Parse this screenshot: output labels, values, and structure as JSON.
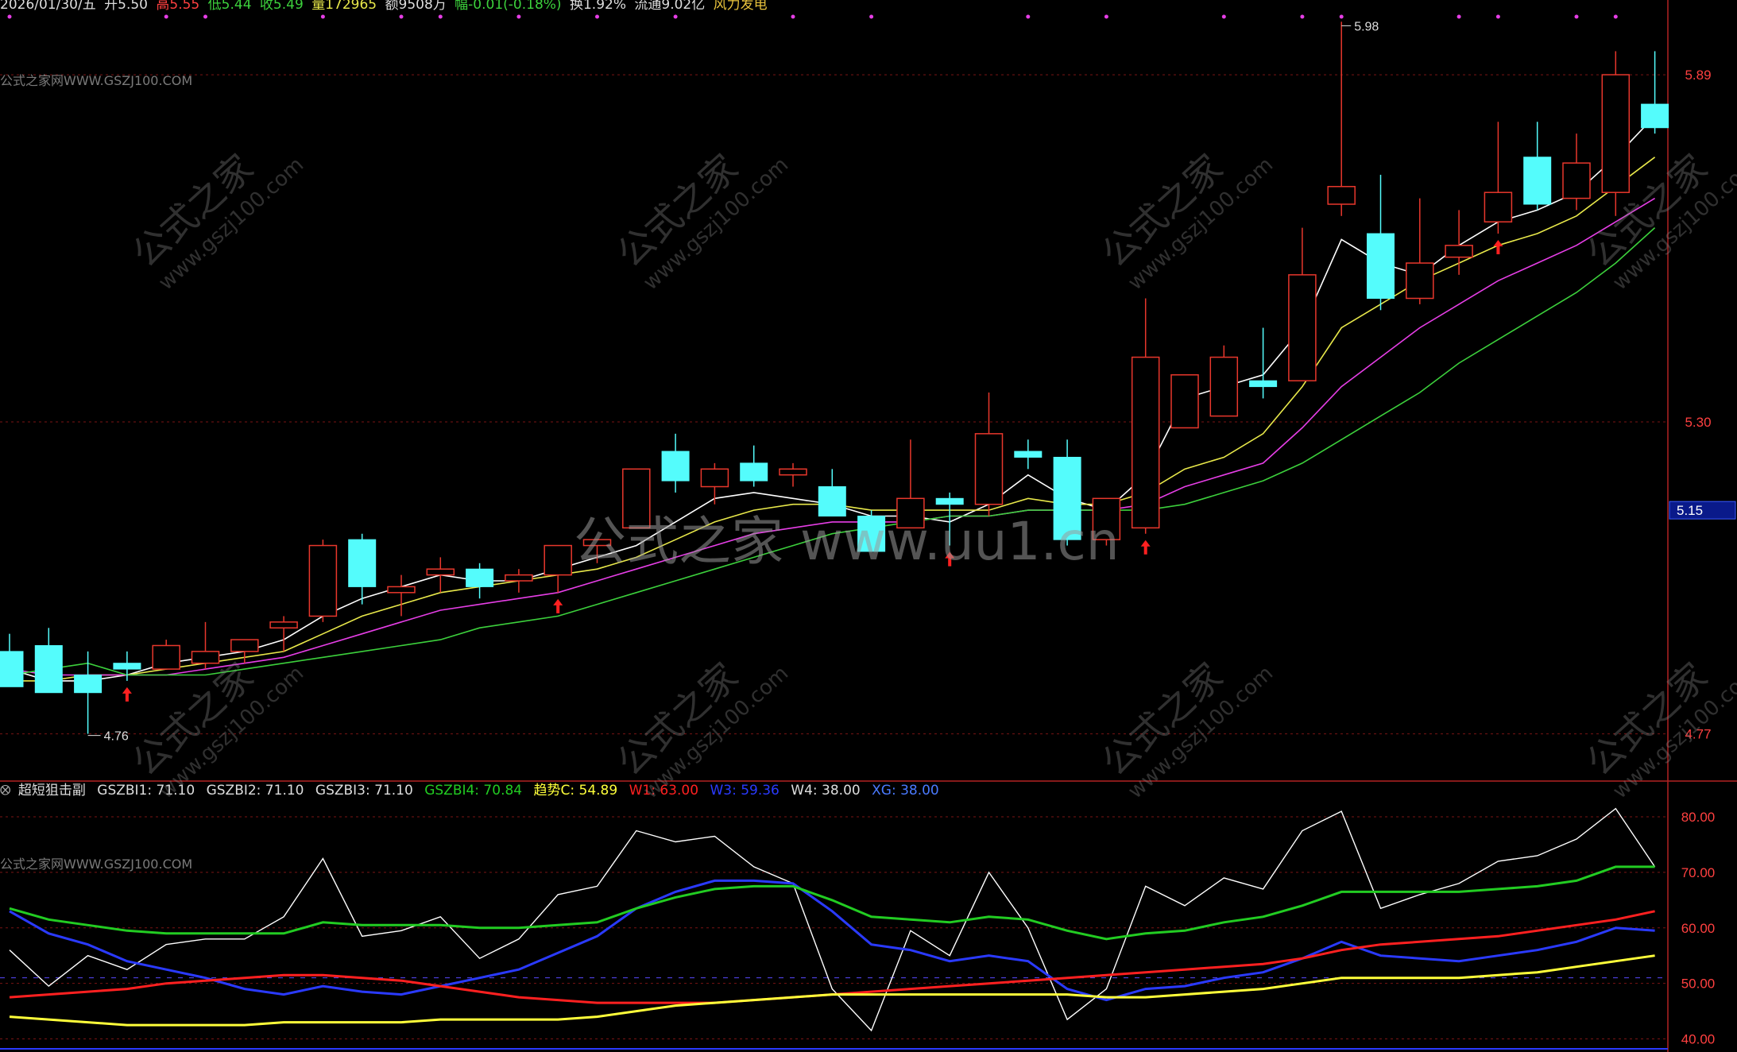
{
  "header": {
    "date": "2026/01/30/五",
    "open": "开5.50",
    "high": "高5.55",
    "low": "低5.44",
    "close": "收5.49",
    "volume": "量172965",
    "amount": "额9508万",
    "change": "幅-0.01(-0.18%)",
    "turnover": "换1.92%",
    "float_cap": "流通9.02亿",
    "sector": "风力发电"
  },
  "source_label": "公式之家网WWW.GSZJ100.COM",
  "watermark": {
    "center": "公式之家 www.uu1.cn",
    "tile": "公式之家",
    "tile_url": "www.gszj100.com"
  },
  "colors": {
    "bg": "#000000",
    "up": "#e8372c",
    "down": "#54fcfc",
    "grid": "#8b1a1a",
    "ma1": "#ffffff",
    "ma2": "#e8e84a",
    "ma3": "#e63ee6",
    "ma4": "#3cd03c",
    "w1": "#ff2020",
    "w3": "#2a3aff",
    "trend": "#ffff3a",
    "gszb4": "#22cc22"
  },
  "chart_data": [
    {
      "type": "candlestick",
      "y_ticks": [
        "5.89",
        "5.30",
        "4.77"
      ],
      "current_price_label": "5.15",
      "high_label": "5.98",
      "low_label": "4.76",
      "ylim": [
        4.71,
        5.99
      ],
      "candles": [
        {
          "o": 4.91,
          "h": 4.94,
          "l": 4.85,
          "c": 4.85
        },
        {
          "o": 4.92,
          "h": 4.95,
          "l": 4.84,
          "c": 4.84
        },
        {
          "o": 4.87,
          "h": 4.91,
          "l": 4.77,
          "c": 4.84
        },
        {
          "o": 4.89,
          "h": 4.91,
          "l": 4.86,
          "c": 4.88
        },
        {
          "o": 4.88,
          "h": 4.93,
          "l": 4.88,
          "c": 4.92
        },
        {
          "o": 4.89,
          "h": 4.96,
          "l": 4.88,
          "c": 4.91
        },
        {
          "o": 4.91,
          "h": 4.93,
          "l": 4.89,
          "c": 4.93
        },
        {
          "o": 4.95,
          "h": 4.97,
          "l": 4.91,
          "c": 4.96
        },
        {
          "o": 4.97,
          "h": 5.1,
          "l": 4.96,
          "c": 5.09
        },
        {
          "o": 5.1,
          "h": 5.11,
          "l": 4.99,
          "c": 5.02
        },
        {
          "o": 5.01,
          "h": 5.04,
          "l": 4.97,
          "c": 5.02
        },
        {
          "o": 5.04,
          "h": 5.07,
          "l": 5.01,
          "c": 5.05
        },
        {
          "o": 5.05,
          "h": 5.06,
          "l": 5.0,
          "c": 5.02
        },
        {
          "o": 5.03,
          "h": 5.05,
          "l": 5.01,
          "c": 5.04
        },
        {
          "o": 5.04,
          "h": 5.09,
          "l": 5.01,
          "c": 5.09
        },
        {
          "o": 5.09,
          "h": 5.1,
          "l": 5.06,
          "c": 5.1
        },
        {
          "o": 5.12,
          "h": 5.22,
          "l": 5.12,
          "c": 5.22
        },
        {
          "o": 5.25,
          "h": 5.28,
          "l": 5.18,
          "c": 5.2
        },
        {
          "o": 5.19,
          "h": 5.23,
          "l": 5.16,
          "c": 5.22
        },
        {
          "o": 5.23,
          "h": 5.26,
          "l": 5.19,
          "c": 5.2
        },
        {
          "o": 5.21,
          "h": 5.23,
          "l": 5.19,
          "c": 5.22
        },
        {
          "o": 5.19,
          "h": 5.22,
          "l": 5.14,
          "c": 5.14
        },
        {
          "o": 5.14,
          "h": 5.15,
          "l": 5.08,
          "c": 5.08
        },
        {
          "o": 5.12,
          "h": 5.27,
          "l": 5.12,
          "c": 5.17
        },
        {
          "o": 5.17,
          "h": 5.18,
          "l": 5.09,
          "c": 5.16
        },
        {
          "o": 5.16,
          "h": 5.35,
          "l": 5.14,
          "c": 5.28
        },
        {
          "o": 5.25,
          "h": 5.27,
          "l": 5.22,
          "c": 5.24
        },
        {
          "o": 5.24,
          "h": 5.27,
          "l": 5.09,
          "c": 5.1
        },
        {
          "o": 5.1,
          "h": 5.17,
          "l": 5.09,
          "c": 5.17
        },
        {
          "o": 5.12,
          "h": 5.51,
          "l": 5.11,
          "c": 5.41
        },
        {
          "o": 5.29,
          "h": 5.38,
          "l": 5.29,
          "c": 5.38
        },
        {
          "o": 5.31,
          "h": 5.43,
          "l": 5.31,
          "c": 5.41
        },
        {
          "o": 5.37,
          "h": 5.46,
          "l": 5.34,
          "c": 5.36
        },
        {
          "o": 5.37,
          "h": 5.63,
          "l": 5.37,
          "c": 5.55
        },
        {
          "o": 5.67,
          "h": 5.98,
          "l": 5.65,
          "c": 5.7
        },
        {
          "o": 5.62,
          "h": 5.72,
          "l": 5.49,
          "c": 5.51
        },
        {
          "o": 5.51,
          "h": 5.68,
          "l": 5.5,
          "c": 5.57
        },
        {
          "o": 5.58,
          "h": 5.66,
          "l": 5.55,
          "c": 5.6
        },
        {
          "o": 5.64,
          "h": 5.81,
          "l": 5.62,
          "c": 5.69
        },
        {
          "o": 5.75,
          "h": 5.81,
          "l": 5.66,
          "c": 5.67
        },
        {
          "o": 5.68,
          "h": 5.79,
          "l": 5.66,
          "c": 5.74
        },
        {
          "o": 5.69,
          "h": 5.93,
          "l": 5.65,
          "c": 5.89
        },
        {
          "o": 5.84,
          "h": 5.93,
          "l": 5.79,
          "c": 5.8
        }
      ],
      "ma_lines": [
        {
          "color_key": "ma1",
          "values": [
            4.88,
            4.86,
            4.86,
            4.87,
            4.89,
            4.9,
            4.91,
            4.93,
            4.97,
            5.0,
            5.02,
            5.04,
            5.03,
            5.03,
            5.05,
            5.07,
            5.09,
            5.13,
            5.17,
            5.18,
            5.17,
            5.16,
            5.14,
            5.14,
            5.13,
            5.16,
            5.21,
            5.17,
            5.15,
            5.21,
            5.34,
            5.36,
            5.38,
            5.46,
            5.61,
            5.57,
            5.55,
            5.6,
            5.64,
            5.66,
            5.69,
            5.75,
            5.82
          ]
        },
        {
          "color_key": "ma2",
          "values": [
            4.86,
            4.86,
            4.87,
            4.87,
            4.88,
            4.89,
            4.9,
            4.91,
            4.94,
            4.97,
            4.99,
            5.01,
            5.02,
            5.03,
            5.04,
            5.05,
            5.07,
            5.1,
            5.13,
            5.15,
            5.16,
            5.16,
            5.15,
            5.15,
            5.15,
            5.15,
            5.17,
            5.16,
            5.16,
            5.18,
            5.22,
            5.24,
            5.28,
            5.36,
            5.46,
            5.5,
            5.54,
            5.57,
            5.6,
            5.62,
            5.65,
            5.7,
            5.75
          ]
        },
        {
          "color_key": "ma3",
          "values": [
            4.88,
            4.87,
            4.87,
            4.87,
            4.87,
            4.88,
            4.89,
            4.9,
            4.92,
            4.94,
            4.96,
            4.98,
            4.99,
            5.0,
            5.01,
            5.03,
            5.05,
            5.07,
            5.09,
            5.11,
            5.12,
            5.13,
            5.13,
            5.13,
            5.14,
            5.14,
            5.15,
            5.15,
            5.15,
            5.16,
            5.19,
            5.21,
            5.23,
            5.29,
            5.36,
            5.41,
            5.46,
            5.5,
            5.54,
            5.57,
            5.6,
            5.64,
            5.68
          ]
        },
        {
          "color_key": "ma4",
          "values": [
            4.87,
            4.88,
            4.89,
            4.87,
            4.87,
            4.87,
            4.88,
            4.89,
            4.9,
            4.91,
            4.92,
            4.93,
            4.95,
            4.96,
            4.97,
            4.99,
            5.01,
            5.03,
            5.05,
            5.07,
            5.09,
            5.11,
            5.12,
            5.13,
            5.14,
            5.14,
            5.15,
            5.15,
            5.15,
            5.15,
            5.16,
            5.18,
            5.2,
            5.23,
            5.27,
            5.31,
            5.35,
            5.4,
            5.44,
            5.48,
            5.52,
            5.57,
            5.63
          ]
        }
      ],
      "buy_signal_bars": [
        3,
        14,
        24,
        29,
        38
      ],
      "magenta_dot_bars": [
        0,
        4,
        5,
        8,
        10,
        11,
        13,
        15,
        17,
        20,
        22,
        26,
        28,
        31,
        33,
        34,
        37,
        38,
        40,
        41
      ]
    },
    {
      "type": "line",
      "title": "超短狙击副",
      "legend": [
        {
          "label": "GSZBI1: 71.10",
          "color_key": "ma1"
        },
        {
          "label": "GSZBI2: 71.10",
          "color_key": "ma1"
        },
        {
          "label": "GSZBI3: 71.10",
          "color_key": "ma1"
        },
        {
          "label": "GSZBI4: 70.84",
          "color_key": "gszb4"
        },
        {
          "label": "趋势C: 54.89",
          "color_key": "trend"
        },
        {
          "label": "W1: 63.00",
          "color_key": "w1"
        },
        {
          "label": "W3: 59.36",
          "color_key": "w3"
        },
        {
          "label": "W4: 38.00",
          "color_key": "ma1"
        },
        {
          "label": "XG: 38.00",
          "color_key": "w3"
        }
      ],
      "y_ticks": [
        "80.00",
        "70.00",
        "60.00",
        "50.00",
        "40.00"
      ],
      "ylim": [
        38.5,
        83.3
      ],
      "dashed_level": 51,
      "series": [
        {
          "color_key": "ma1",
          "values": [
            56,
            49.5,
            55,
            52.5,
            57,
            58,
            58,
            62,
            72.5,
            58.5,
            59.5,
            62,
            54.5,
            58,
            66,
            67.5,
            77.5,
            75.5,
            76.5,
            71,
            68,
            49,
            41.5,
            59.5,
            55,
            70,
            60,
            43.5,
            49,
            67.5,
            64,
            69,
            67,
            77.5,
            81,
            63.5,
            66,
            68,
            72,
            73,
            76,
            81.5,
            71
          ]
        },
        {
          "color_key": "w3",
          "values": [
            63,
            59,
            57,
            54,
            52.5,
            51,
            49,
            48,
            49.5,
            48.5,
            48,
            49.5,
            51,
            52.5,
            55.5,
            58.5,
            63.5,
            66.5,
            68.5,
            68.5,
            68,
            63,
            57,
            56,
            54,
            55,
            54,
            49,
            47,
            49,
            49.5,
            51,
            52,
            54.5,
            57.5,
            55,
            54.5,
            54,
            55,
            56,
            57.5,
            60,
            59.5
          ]
        },
        {
          "color_key": "gszb4",
          "values": [
            63.5,
            61.5,
            60.5,
            59.5,
            59,
            59,
            59,
            59,
            61,
            60.5,
            60.5,
            60.5,
            60,
            60,
            60.5,
            61,
            63.5,
            65.5,
            67,
            67.5,
            67.5,
            65,
            62,
            61.5,
            61,
            62,
            61.5,
            59.5,
            58,
            59,
            59.5,
            61,
            62,
            64,
            66.5,
            66.5,
            66.5,
            66.5,
            67,
            67.5,
            68.5,
            71,
            71
          ]
        },
        {
          "color_key": "w1",
          "values": [
            47.5,
            48,
            48.5,
            49,
            50,
            50.5,
            51,
            51.5,
            51.5,
            51,
            50.5,
            49.5,
            48.5,
            47.5,
            47,
            46.5,
            46.5,
            46.5,
            46.5,
            47,
            47.5,
            48,
            48.5,
            49,
            49.5,
            50,
            50.5,
            51,
            51.5,
            52,
            52.5,
            53,
            53.5,
            54.5,
            56,
            57,
            57.5,
            58,
            58.5,
            59.5,
            60.5,
            61.5,
            63
          ]
        },
        {
          "color_key": "trend",
          "values": [
            44,
            43.5,
            43,
            42.5,
            42.5,
            42.5,
            42.5,
            43,
            43,
            43,
            43,
            43.5,
            43.5,
            43.5,
            43.5,
            44,
            45,
            46,
            46.5,
            47,
            47.5,
            48,
            48,
            48,
            48,
            48,
            48,
            48,
            47.5,
            47.5,
            48,
            48.5,
            49,
            50,
            51,
            51,
            51,
            51,
            51.5,
            52,
            53,
            54,
            55
          ]
        }
      ]
    }
  ]
}
